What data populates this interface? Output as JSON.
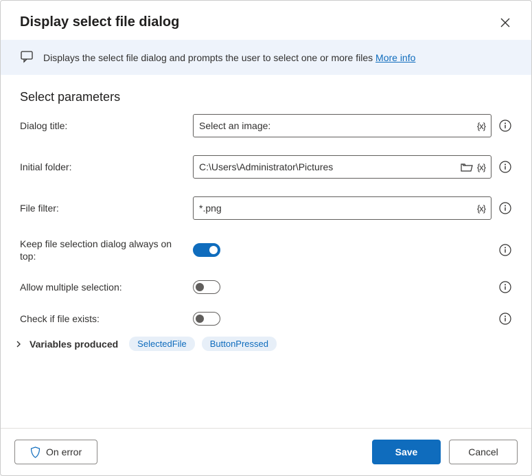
{
  "dialog": {
    "title": "Display select file dialog"
  },
  "banner": {
    "text": "Displays the select file dialog and prompts the user to select one or more files",
    "link": "More info"
  },
  "section": {
    "title": "Select parameters"
  },
  "fields": {
    "dialog_title": {
      "label": "Dialog title:",
      "value": "Select an image:"
    },
    "initial_folder": {
      "label": "Initial folder:",
      "value": "C:\\Users\\Administrator\\Pictures"
    },
    "file_filter": {
      "label": "File filter:",
      "value": "*.png"
    },
    "always_on_top": {
      "label": "Keep file selection dialog always on top:",
      "on": true
    },
    "allow_multiple": {
      "label": "Allow multiple selection:",
      "on": false
    },
    "check_exists": {
      "label": "Check if file exists:",
      "on": false
    }
  },
  "variables": {
    "label": "Variables produced",
    "items": [
      "SelectedFile",
      "ButtonPressed"
    ]
  },
  "footer": {
    "on_error": "On error",
    "save": "Save",
    "cancel": "Cancel"
  }
}
